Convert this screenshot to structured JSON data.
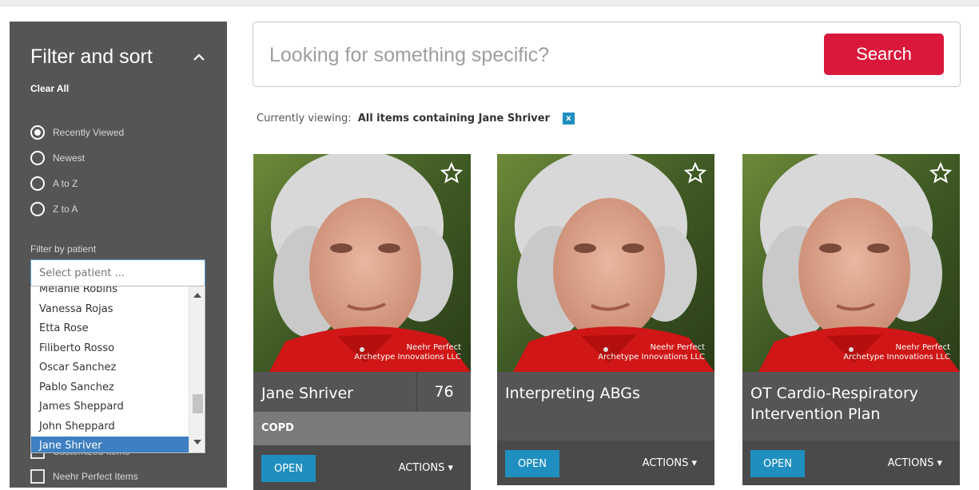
{
  "sidebar": {
    "title": "Filter and sort",
    "clear_all": "Clear All",
    "sort_options": [
      "Recently Viewed",
      "Newest",
      "A to Z",
      "Z to A"
    ],
    "selected_sort": "Recently Viewed",
    "filter_label": "Filter by patient",
    "patient_placeholder": "Select patient ...",
    "checkboxes": [
      "Customized Items",
      "Neehr Perfect Items"
    ]
  },
  "dropdown": {
    "items": [
      "Melanie Robins",
      "Vanessa Rojas",
      "Etta Rose",
      "Filiberto Rosso",
      "Oscar Sanchez",
      "Pablo Sanchez",
      "James Sheppard",
      "John Sheppard",
      "Jane Shriver"
    ],
    "selected": "Jane Shriver"
  },
  "search": {
    "placeholder": "Looking for something specific?",
    "button": "Search"
  },
  "viewing": {
    "prefix": "Currently viewing:",
    "filter": "All items containing Jane Shriver",
    "clear": "x"
  },
  "cards": [
    {
      "title": "Jane Shriver",
      "score": "76",
      "tag": "COPD",
      "open": "OPEN",
      "actions": "ACTIONS",
      "watermark_1": "Neehr Perfect",
      "watermark_2": "Archetype Innovations LLC"
    },
    {
      "title": "Interpreting ABGs",
      "open": "OPEN",
      "actions": "ACTIONS",
      "watermark_1": "Neehr Perfect",
      "watermark_2": "Archetype Innovations LLC"
    },
    {
      "title": "OT Cardio-Respiratory Intervention Plan",
      "open": "OPEN",
      "actions": "ACTIONS",
      "watermark_1": "Neehr Perfect",
      "watermark_2": "Archetype Innovations LLC"
    }
  ],
  "colors": {
    "sidebar_bg": "#555555",
    "accent_red": "#d9183b",
    "accent_blue": "#1f8fbf",
    "selected_blue": "#3d7fc1"
  }
}
